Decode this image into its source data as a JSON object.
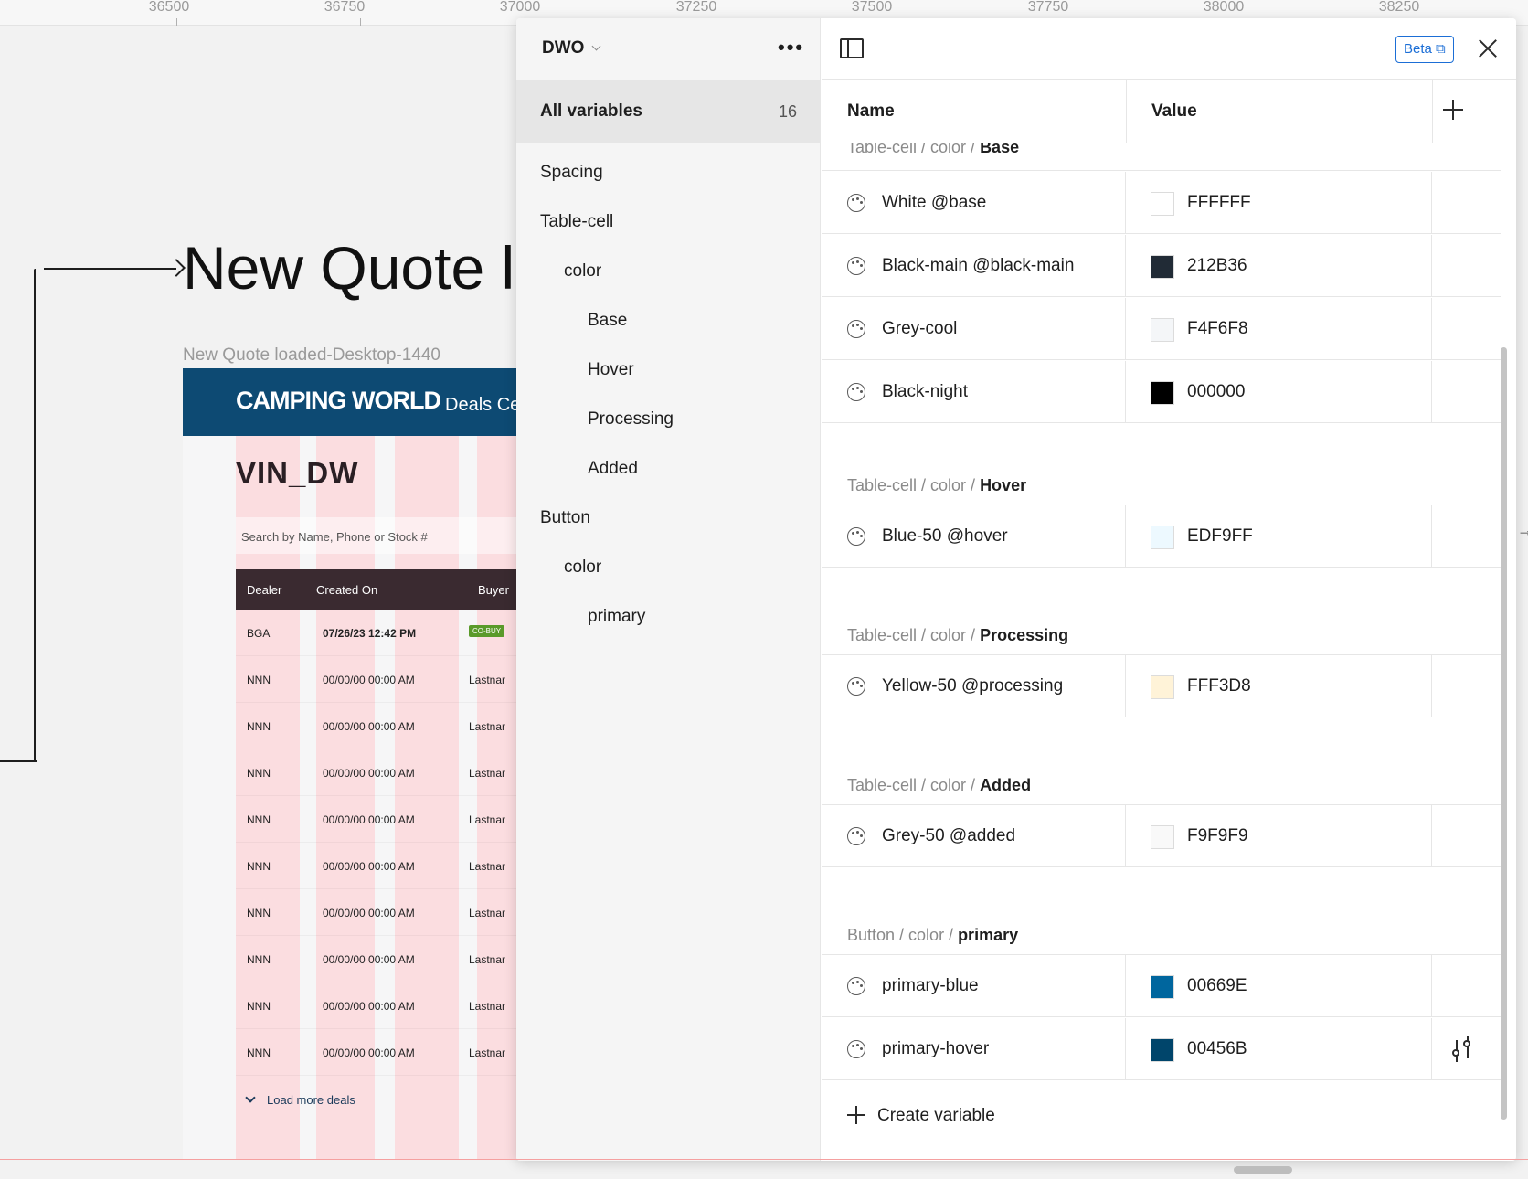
{
  "ruler": {
    "ticks": [
      "36500",
      "36750",
      "37000",
      "37250",
      "37500",
      "37750",
      "38000",
      "38250"
    ]
  },
  "canvas": {
    "frame_heading": "New Quote lo",
    "frame_label": "New Quote loaded-Desktop-1440",
    "design": {
      "logo": "CAMPING WORLD",
      "logo_sub": "Deals Cen",
      "title": "VIN_DW",
      "search_placeholder": "Search by Name, Phone or Stock #",
      "columns": [
        "Dealer",
        "Created On",
        "Buyer"
      ],
      "rows": [
        {
          "dealer": "BGA",
          "created": "07/26/23 12:42 PM",
          "buyer": "CO-BUY"
        },
        {
          "dealer": "NNN",
          "created": "00/00/00 00:00 AM",
          "buyer": "Lastnar"
        },
        {
          "dealer": "NNN",
          "created": "00/00/00 00:00 AM",
          "buyer": "Lastnar"
        },
        {
          "dealer": "NNN",
          "created": "00/00/00 00:00 AM",
          "buyer": "Lastnar"
        },
        {
          "dealer": "NNN",
          "created": "00/00/00 00:00 AM",
          "buyer": "Lastnar"
        },
        {
          "dealer": "NNN",
          "created": "00/00/00 00:00 AM",
          "buyer": "Lastnar"
        },
        {
          "dealer": "NNN",
          "created": "00/00/00 00:00 AM",
          "buyer": "Lastnar"
        },
        {
          "dealer": "NNN",
          "created": "00/00/00 00:00 AM",
          "buyer": "Lastnar"
        },
        {
          "dealer": "NNN",
          "created": "00/00/00 00:00 AM",
          "buyer": "Lastnar"
        },
        {
          "dealer": "NNN",
          "created": "00/00/00 00:00 AM",
          "buyer": "Lastnar"
        }
      ],
      "load_more": "Load more deals"
    }
  },
  "panel": {
    "collection": "DWO",
    "all_variables_label": "All variables",
    "all_variables_count": "16",
    "sidebar_items": [
      "Spacing",
      "Table-cell",
      "color",
      "Base",
      "Hover",
      "Processing",
      "Added",
      "Button",
      "color",
      "primary"
    ],
    "beta_label": "Beta",
    "columns": {
      "name": "Name",
      "value": "Value"
    },
    "groups": [
      {
        "prefix": "Table-cell / color / ",
        "name": "Base"
      },
      {
        "prefix": "Table-cell / color / ",
        "name": "Hover"
      },
      {
        "prefix": "Table-cell / color / ",
        "name": "Processing"
      },
      {
        "prefix": "Table-cell / color / ",
        "name": "Added"
      },
      {
        "prefix": "Button / color / ",
        "name": "primary"
      }
    ],
    "variables": [
      {
        "name": "White @base",
        "value": "FFFFFF",
        "color": "#FFFFFF"
      },
      {
        "name": "Black-main @black-main",
        "value": "212B36",
        "color": "#212B36"
      },
      {
        "name": "Grey-cool",
        "value": "F4F6F8",
        "color": "#F4F6F8"
      },
      {
        "name": "Black-night",
        "value": "000000",
        "color": "#000000"
      },
      {
        "name": "Blue-50 @hover",
        "value": "EDF9FF",
        "color": "#EDF9FF"
      },
      {
        "name": "Yellow-50 @processing",
        "value": "FFF3D8",
        "color": "#FFF3D8"
      },
      {
        "name": "Grey-50 @added",
        "value": "F9F9F9",
        "color": "#F9F9F9"
      },
      {
        "name": "primary-blue",
        "value": "00669E",
        "color": "#00669E"
      },
      {
        "name": "primary-hover",
        "value": "00456B",
        "color": "#00456B"
      }
    ],
    "create_variable": "Create variable"
  }
}
